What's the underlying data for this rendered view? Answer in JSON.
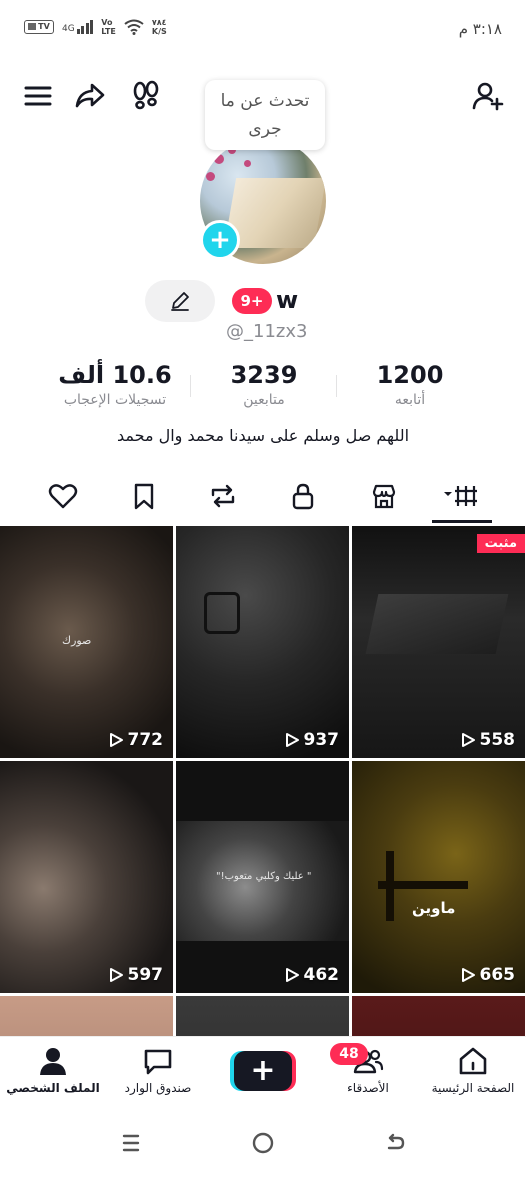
{
  "status_bar": {
    "tv_label": "TV",
    "signal_label": "4G",
    "volte_top": "Vo",
    "volte_bottom": "LTE",
    "speed_value": "٧٨٤",
    "speed_unit": "K/S",
    "time": "٣:١٨ م"
  },
  "note": {
    "text": "تحدث عن ما جرى"
  },
  "profile": {
    "notification_badge": "9+",
    "display_name": "w",
    "username": "@_11zx3",
    "bio": "اللهم صل وسلم على سيدنا محمد وال محمد"
  },
  "stats": {
    "likes": {
      "value": "10.6 ألف",
      "label": "تسجيلات الإعجاب"
    },
    "followers": {
      "value": "3239",
      "label": "متابعين"
    },
    "following": {
      "value": "1200",
      "label": "أتابعه"
    }
  },
  "videos": [
    {
      "views": "772",
      "overlay": "صورك"
    },
    {
      "views": "937",
      "overlay": ""
    },
    {
      "views": "558",
      "pinned_label": "مثبت",
      "overlay": ""
    },
    {
      "views": "597",
      "overlay": ""
    },
    {
      "views": "462",
      "overlay": "\" عليك وكلبي متعوب!\""
    },
    {
      "views": "665",
      "overlay": "ماوين"
    }
  ],
  "bottom_nav": {
    "home": "الصفحة الرئيسية",
    "friends": "الأصدقاء",
    "friends_badge": "48",
    "inbox": "صندوق الوارد",
    "profile": "الملف الشخصي"
  },
  "icons": {
    "top_left": [
      "menu-icon",
      "share-icon",
      "footprints-icon"
    ],
    "top_right": "add-user-icon",
    "tabs": [
      "liked-icon",
      "favorites-icon",
      "reposts-icon",
      "private-icon",
      "shop-icon",
      "videos-grid-icon"
    ]
  },
  "colors": {
    "accent_red": "#fe2c55",
    "accent_cyan": "#20d5ec",
    "text_primary": "#161823",
    "text_secondary": "#8a8b91"
  }
}
